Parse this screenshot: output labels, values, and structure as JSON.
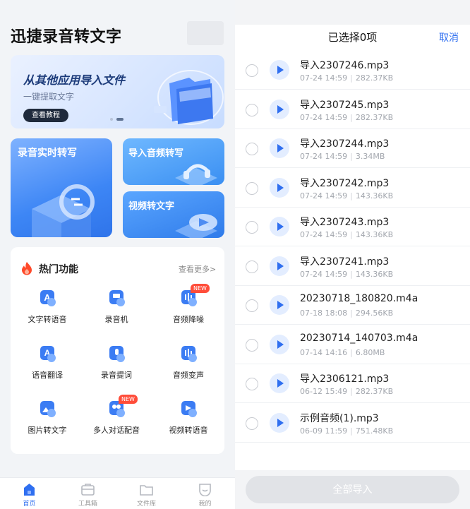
{
  "left": {
    "app_title": "迅捷录音转文字",
    "banner": {
      "title": "从其他应用导入文件",
      "subtitle": "一键提取文字",
      "button": "查看教程"
    },
    "cards": {
      "realtime": "录音实时转写",
      "import_audio": "导入音频转写",
      "video": "视频转文字"
    },
    "hot": {
      "title": "热门功能",
      "more": "查看更多>",
      "items": [
        {
          "label": "文字转语音",
          "icon": "text-to-speech-icon",
          "badge": ""
        },
        {
          "label": "录音机",
          "icon": "recorder-icon",
          "badge": ""
        },
        {
          "label": "音频降噪",
          "icon": "noise-reduction-icon",
          "badge": "NEW"
        },
        {
          "label": "语音翻译",
          "icon": "voice-translate-icon",
          "badge": ""
        },
        {
          "label": "录音提词",
          "icon": "teleprompter-icon",
          "badge": ""
        },
        {
          "label": "音频变声",
          "icon": "voice-changer-icon",
          "badge": ""
        },
        {
          "label": "图片转文字",
          "icon": "image-to-text-icon",
          "badge": ""
        },
        {
          "label": "多人对话配音",
          "icon": "multi-dubbing-icon",
          "badge": "NEW"
        },
        {
          "label": "视频转语音",
          "icon": "video-to-audio-icon",
          "badge": ""
        }
      ]
    },
    "tabs": [
      {
        "label": "首页",
        "icon": "home-icon",
        "active": true
      },
      {
        "label": "工具箱",
        "icon": "toolbox-icon",
        "active": false
      },
      {
        "label": "文件库",
        "icon": "folder-icon",
        "active": false
      },
      {
        "label": "我的",
        "icon": "profile-icon",
        "active": false
      }
    ],
    "colors": {
      "accent": "#2f6ff0",
      "badge": "#ff4d3a"
    }
  },
  "right": {
    "title": "已选择0项",
    "cancel": "取消",
    "files": [
      {
        "name": "导入2307246.mp3",
        "date": "07-24 14:59",
        "size": "282.37KB"
      },
      {
        "name": "导入2307245.mp3",
        "date": "07-24 14:59",
        "size": "282.37KB"
      },
      {
        "name": "导入2307244.mp3",
        "date": "07-24 14:59",
        "size": "3.34MB"
      },
      {
        "name": "导入2307242.mp3",
        "date": "07-24 14:59",
        "size": "143.36KB"
      },
      {
        "name": "导入2307243.mp3",
        "date": "07-24 14:59",
        "size": "143.36KB"
      },
      {
        "name": "导入2307241.mp3",
        "date": "07-24 14:59",
        "size": "143.36KB"
      },
      {
        "name": "20230718_180820.m4a",
        "date": "07-18 18:08",
        "size": "294.56KB"
      },
      {
        "name": "20230714_140703.m4a",
        "date": "07-14 14:16",
        "size": "6.80MB"
      },
      {
        "name": "导入2306121.mp3",
        "date": "06-12 15:49",
        "size": "282.37KB"
      },
      {
        "name": "示例音频(1).mp3",
        "date": "06-09 11:59",
        "size": "751.48KB"
      }
    ],
    "import_button": "全部导入"
  }
}
